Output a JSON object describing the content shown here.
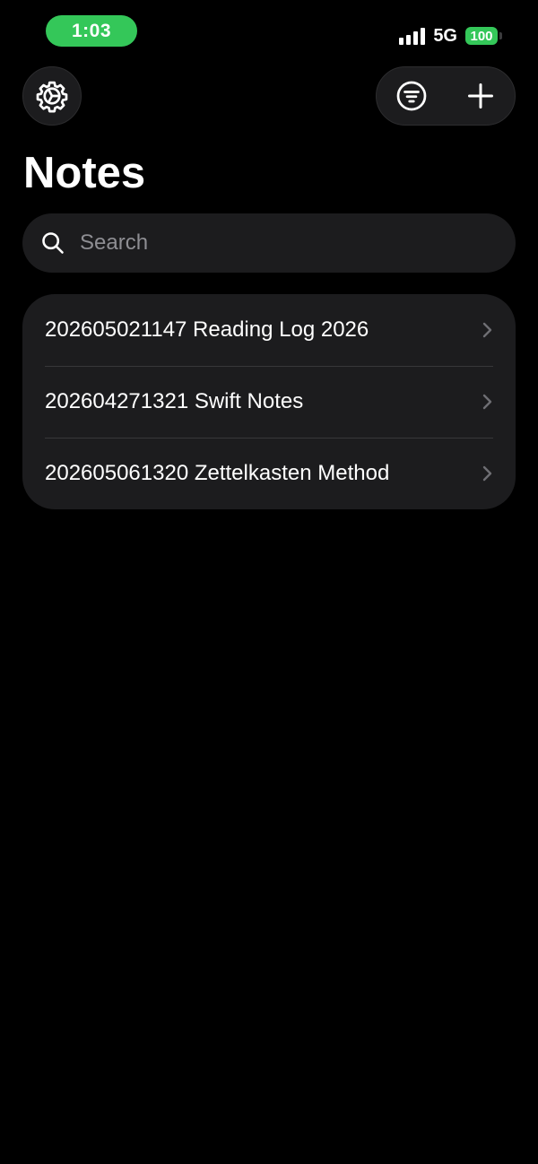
{
  "status_bar": {
    "time": "1:03",
    "network": "5G",
    "battery": "100"
  },
  "toolbar": {
    "settings_icon": "gear-icon",
    "filter_icon": "filter-icon",
    "add_icon": "plus-icon"
  },
  "header": {
    "title": "Notes"
  },
  "search": {
    "placeholder": "Search",
    "value": ""
  },
  "notes": [
    {
      "title": "202605021147 Reading Log 2026"
    },
    {
      "title": "202604271321 Swift Notes"
    },
    {
      "title": "202605061320 Zettelkasten Method"
    }
  ],
  "colors": {
    "accent_green": "#34c759",
    "background": "#000000",
    "card": "#1c1c1e",
    "placeholder": "#8e8e93"
  }
}
